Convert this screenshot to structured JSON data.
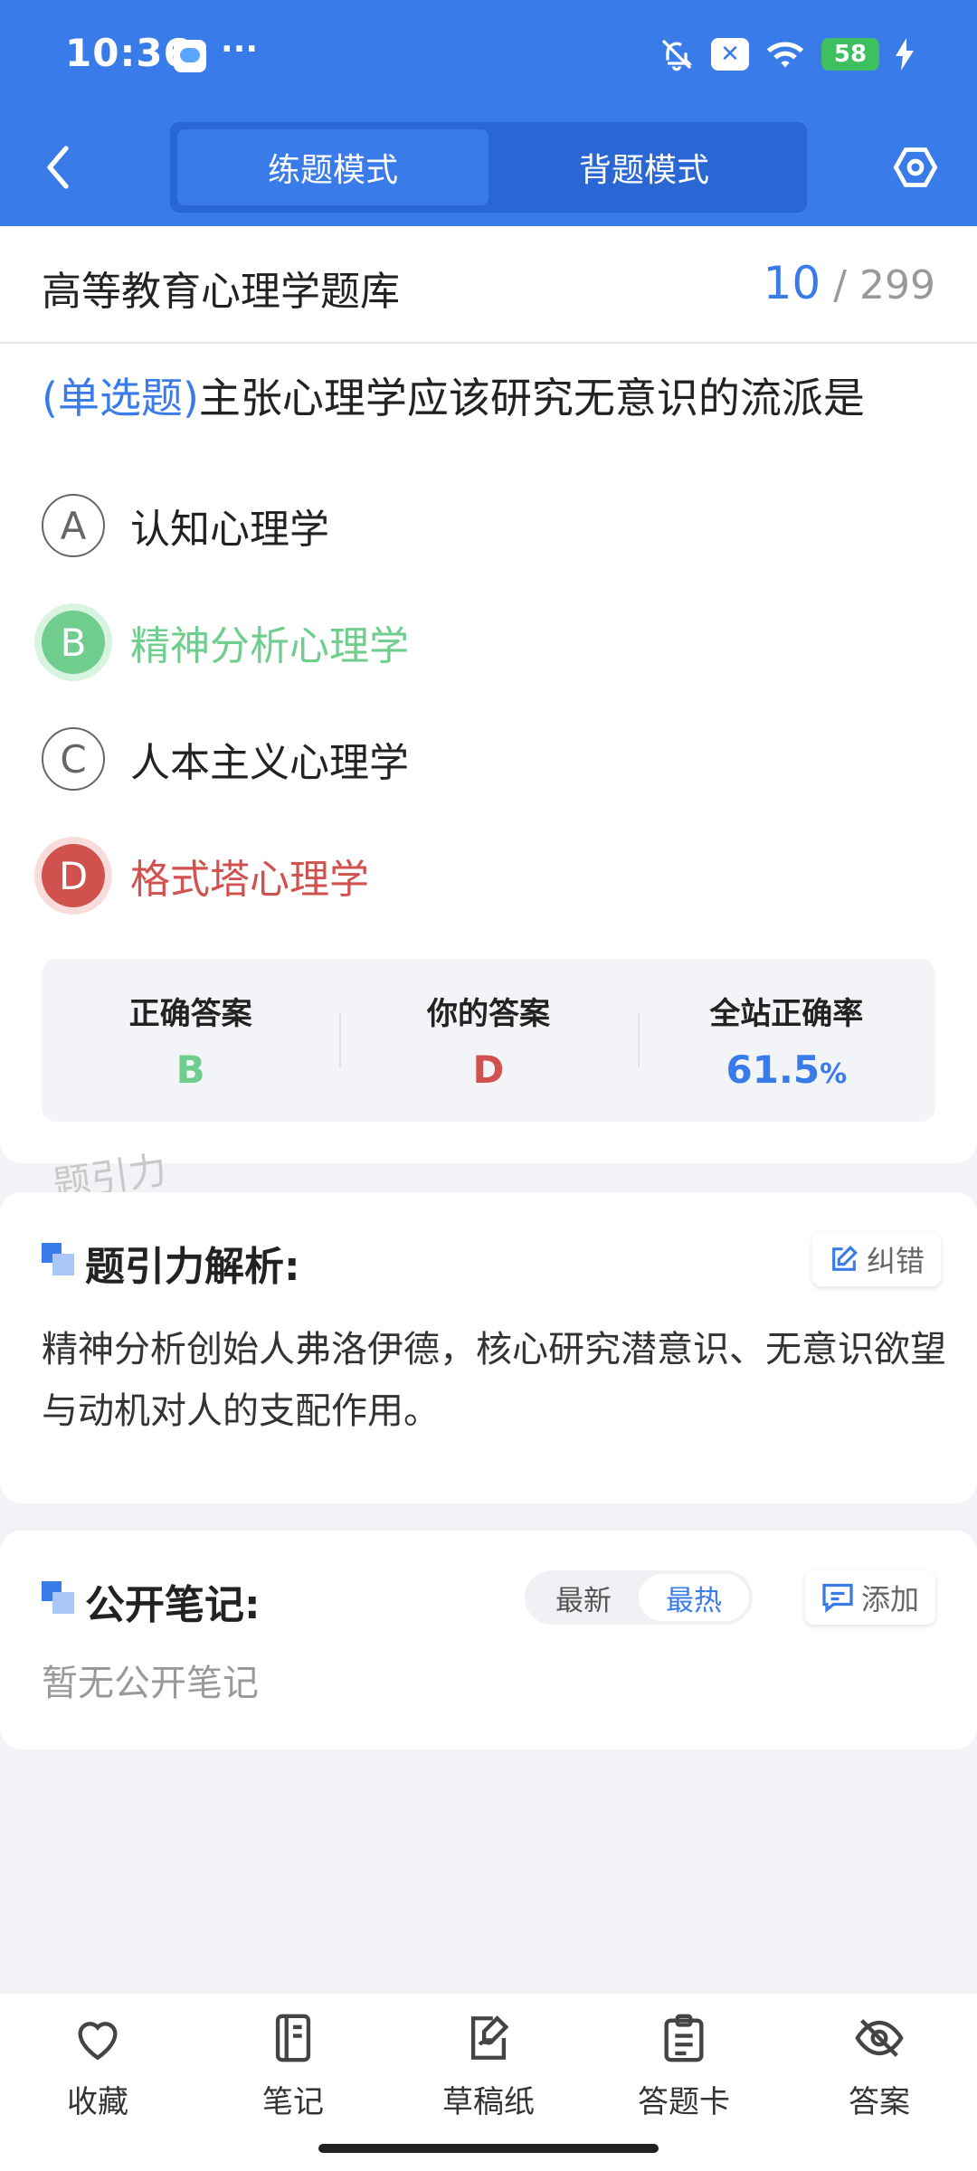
{
  "status_bar": {
    "time": "10:36",
    "dots": "···",
    "battery": "58"
  },
  "header": {
    "tabs": [
      {
        "label": "练题模式",
        "active": true
      },
      {
        "label": "背题模式",
        "active": false
      }
    ]
  },
  "question_card": {
    "bank_title": "高等教育心理学题库",
    "current": "10",
    "total": "/ 299",
    "type_label": "(单选题)",
    "question_text": "主张心理学应该研究无意识的流派是",
    "options": [
      {
        "letter": "A",
        "text": "认知心理学",
        "state": "normal"
      },
      {
        "letter": "B",
        "text": "精神分析心理学",
        "state": "correct"
      },
      {
        "letter": "C",
        "text": "人本主义心理学",
        "state": "normal"
      },
      {
        "letter": "D",
        "text": "格式塔心理学",
        "state": "wrong"
      }
    ],
    "stats": {
      "correct_label": "正确答案",
      "correct_value": "B",
      "yours_label": "你的答案",
      "yours_value": "D",
      "rate_label": "全站正确率",
      "rate_value": "61.5",
      "rate_unit": "%"
    }
  },
  "watermark": "题引力",
  "analysis": {
    "title": "题引力解析:",
    "report_label": "纠错",
    "text": "精神分析创始人弗洛伊德，核心研究潜意识、无意识欲望与动机对人的支配作用。"
  },
  "notes": {
    "title": "公开笔记:",
    "sort_options": [
      "最新",
      "最热"
    ],
    "add_label": "添加",
    "empty_text": "暂无公开笔记"
  },
  "bottom_nav": [
    {
      "label": "收藏",
      "icon": "heart-icon"
    },
    {
      "label": "笔记",
      "icon": "notebook-icon"
    },
    {
      "label": "草稿纸",
      "icon": "draft-paper-icon"
    },
    {
      "label": "答题卡",
      "icon": "answer-card-icon"
    },
    {
      "label": "答案",
      "icon": "eye-off-icon"
    }
  ],
  "colors": {
    "primary": "#3a7bea",
    "correct": "#6fcd8e",
    "wrong": "#d0514e"
  }
}
